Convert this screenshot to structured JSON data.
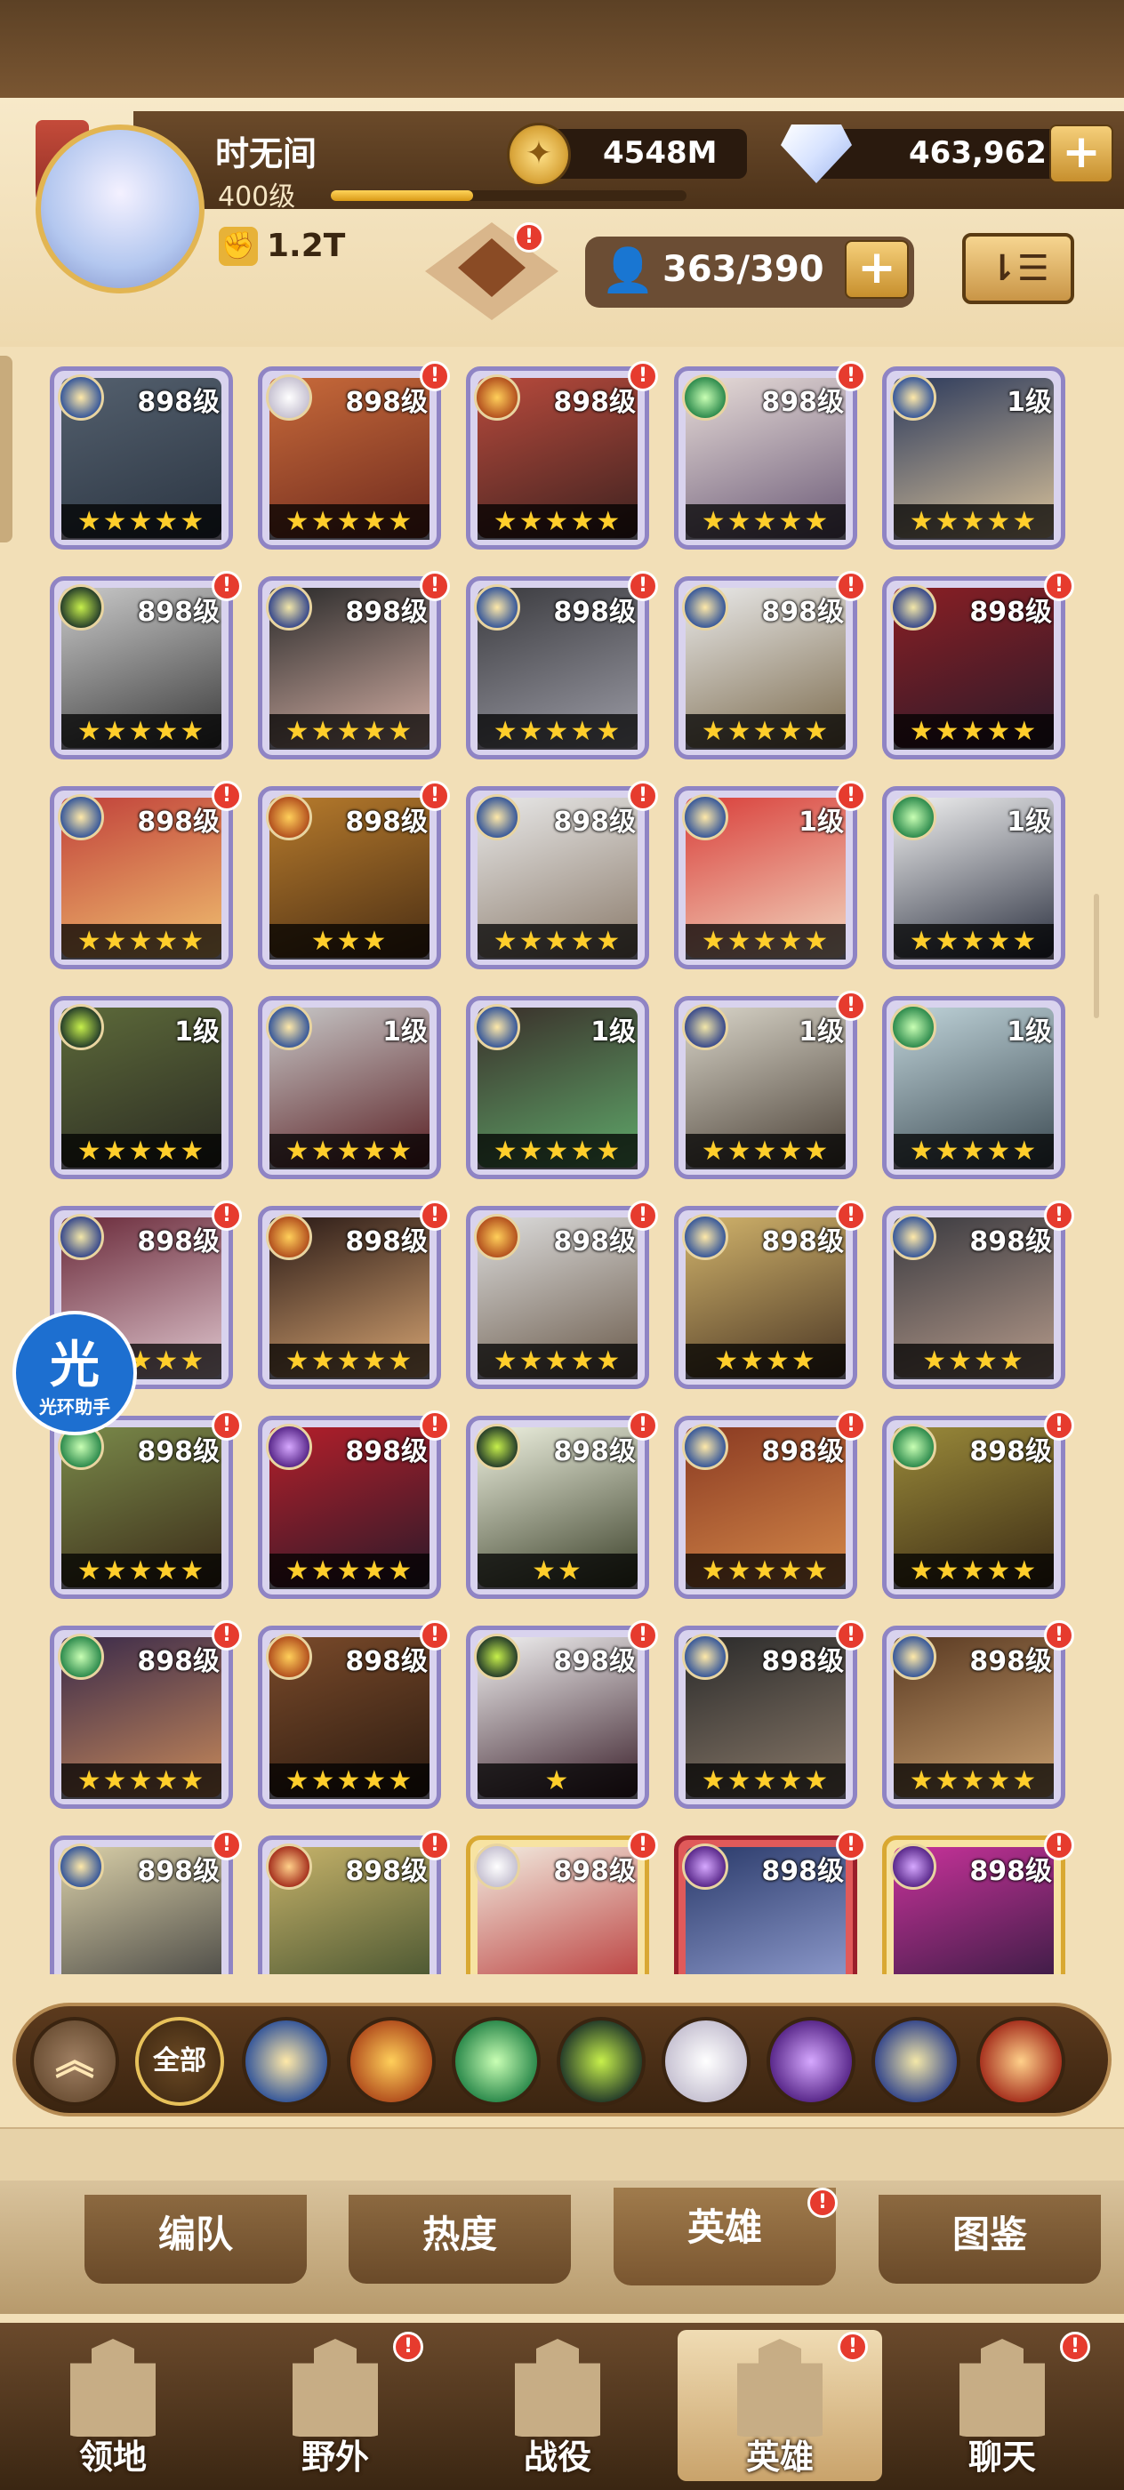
{
  "player": {
    "name": "时无间",
    "level": "400级",
    "xp_progress": 0.4,
    "power": "1.2T"
  },
  "currency": {
    "gold": "4548M",
    "diamonds": "463,962",
    "plus": "+"
  },
  "roster": {
    "count": "363/390",
    "plus": "+"
  },
  "badge": "!",
  "heroes": [
    {
      "level": "898级",
      "faction": "light",
      "stars": "★★★★★",
      "badge": false,
      "frame": "purple",
      "portrait": [
        "#54606e",
        "#2b3542"
      ]
    },
    {
      "level": "898级",
      "faction": "celestial",
      "stars": "★★★★★",
      "badge": true,
      "frame": "purple",
      "portrait": [
        "#c86a3a",
        "#6d2a1e"
      ]
    },
    {
      "level": "898级",
      "faction": "mauler",
      "stars": "★★★★★",
      "badge": true,
      "frame": "purple",
      "portrait": [
        "#b84a3c",
        "#3d2220"
      ]
    },
    {
      "level": "898级",
      "faction": "wilder",
      "stars": "★★★★★",
      "badge": true,
      "frame": "purple",
      "portrait": [
        "#e7dcd8",
        "#6b5a77"
      ]
    },
    {
      "level": "1级",
      "faction": "light",
      "stars": "★★★★★",
      "badge": false,
      "frame": "purple",
      "portrait": [
        "#2c3a5c",
        "#d9c29a"
      ]
    },
    {
      "level": "898级",
      "faction": "graveborn",
      "stars": "★★★★★",
      "badge": true,
      "frame": "purple",
      "portrait": [
        "#c9c9c9",
        "#3a3a3a"
      ]
    },
    {
      "level": "898级",
      "faction": "dimensional",
      "stars": "★★★★★",
      "badge": true,
      "frame": "purple",
      "portrait": [
        "#2a2a2a",
        "#d5b0a5"
      ]
    },
    {
      "level": "898级",
      "faction": "light",
      "stars": "★★★★★",
      "badge": true,
      "frame": "purple",
      "portrait": [
        "#3b3b3f",
        "#9c9ca6"
      ]
    },
    {
      "level": "898级",
      "faction": "light",
      "stars": "★★★★★",
      "badge": true,
      "frame": "purple",
      "portrait": [
        "#e9e9e9",
        "#7b6a4c"
      ]
    },
    {
      "level": "898级",
      "faction": "dimensional",
      "stars": "★★★★★",
      "badge": true,
      "frame": "purple",
      "portrait": [
        "#8a1f24",
        "#2a1a2a"
      ]
    },
    {
      "level": "898级",
      "faction": "light",
      "stars": "★★★★★",
      "badge": true,
      "frame": "purple",
      "portrait": [
        "#c1413a",
        "#f0c070"
      ]
    },
    {
      "level": "898级",
      "faction": "mauler",
      "stars": "★★★",
      "badge": true,
      "frame": "purple",
      "portrait": [
        "#b77b2c",
        "#4a2e14"
      ]
    },
    {
      "level": "898级",
      "faction": "light",
      "stars": "★★★★★",
      "badge": true,
      "frame": "purple",
      "portrait": [
        "#e8e8e8",
        "#8a7a6a"
      ]
    },
    {
      "level": "1级",
      "faction": "light",
      "stars": "★★★★★",
      "badge": true,
      "frame": "purple",
      "portrait": [
        "#d9403b",
        "#f2d7c0"
      ]
    },
    {
      "level": "1级",
      "faction": "wilder",
      "stars": "★★★★★",
      "badge": false,
      "frame": "purple",
      "portrait": [
        "#f1f1f1",
        "#2c3140"
      ]
    },
    {
      "level": "1级",
      "faction": "graveborn",
      "stars": "★★★★★",
      "badge": false,
      "frame": "purple",
      "portrait": [
        "#5d6a3a",
        "#2a2a22"
      ]
    },
    {
      "level": "1级",
      "faction": "light",
      "stars": "★★★★★",
      "badge": false,
      "frame": "purple",
      "portrait": [
        "#c7c7c7",
        "#5a2024"
      ]
    },
    {
      "level": "1级",
      "faction": "light",
      "stars": "★★★★★",
      "badge": false,
      "frame": "purple",
      "portrait": [
        "#3a2f2a",
        "#5fa86a"
      ]
    },
    {
      "level": "1级",
      "faction": "dimensional",
      "stars": "★★★★★",
      "badge": true,
      "frame": "purple",
      "portrait": [
        "#d8d4c8",
        "#4a4036"
      ]
    },
    {
      "level": "1级",
      "faction": "wilder",
      "stars": "★★★★★",
      "badge": false,
      "frame": "purple",
      "portrait": [
        "#bfd3d9",
        "#3c4a52"
      ]
    },
    {
      "level": "898级",
      "faction": "dimensional",
      "stars": "★★★★★",
      "badge": true,
      "frame": "purple",
      "portrait": [
        "#6a2a3a",
        "#e0c7cf"
      ]
    },
    {
      "level": "898级",
      "faction": "mauler",
      "stars": "★★★★★",
      "badge": true,
      "frame": "purple",
      "portrait": [
        "#2a1a16",
        "#d7a573"
      ]
    },
    {
      "level": "898级",
      "faction": "mauler",
      "stars": "★★★★★",
      "badge": true,
      "frame": "purple",
      "portrait": [
        "#dcdcdc",
        "#6a5a4a"
      ]
    },
    {
      "level": "898级",
      "faction": "light",
      "stars": "★★★★",
      "badge": true,
      "frame": "purple",
      "portrait": [
        "#d1b36b",
        "#4a3624"
      ]
    },
    {
      "level": "898级",
      "faction": "light",
      "stars": "★★★★",
      "badge": true,
      "frame": "purple",
      "portrait": [
        "#3a3a40",
        "#b59a8a"
      ]
    },
    {
      "level": "898级",
      "faction": "wilder",
      "stars": "★★★★★",
      "badge": true,
      "frame": "purple",
      "portrait": [
        "#7a8a4a",
        "#3a2a18"
      ]
    },
    {
      "level": "898级",
      "faction": "hypogean",
      "stars": "★★★★★",
      "badge": true,
      "frame": "purple",
      "portrait": [
        "#b41f2a",
        "#2a1a2a"
      ]
    },
    {
      "level": "898级",
      "faction": "graveborn",
      "stars": "★★",
      "badge": true,
      "frame": "purple",
      "portrait": [
        "#eef1e0",
        "#3a3f28"
      ]
    },
    {
      "level": "898级",
      "faction": "light",
      "stars": "★★★★★",
      "badge": true,
      "frame": "purple",
      "portrait": [
        "#8a3a22",
        "#d68a4a"
      ]
    },
    {
      "level": "898级",
      "faction": "wilder",
      "stars": "★★★★★",
      "badge": true,
      "frame": "purple",
      "portrait": [
        "#9a8a3a",
        "#3a2a14"
      ]
    },
    {
      "level": "898级",
      "faction": "wilder",
      "stars": "★★★★★",
      "badge": true,
      "frame": "purple",
      "portrait": [
        "#3a2a4a",
        "#c88a5a"
      ]
    },
    {
      "level": "898级",
      "faction": "mauler",
      "stars": "★★★★★",
      "badge": true,
      "frame": "purple",
      "portrait": [
        "#7a4a2a",
        "#2a1a10"
      ]
    },
    {
      "level": "898级",
      "faction": "graveborn",
      "stars": "★",
      "badge": true,
      "frame": "purple",
      "portrait": [
        "#f2f2f2",
        "#3a1f2a"
      ]
    },
    {
      "level": "898级",
      "faction": "light",
      "stars": "★★★★★",
      "badge": true,
      "frame": "purple",
      "portrait": [
        "#2a2a2a",
        "#8a7a6a"
      ]
    },
    {
      "level": "898级",
      "faction": "light",
      "stars": "★★★★★",
      "badge": true,
      "frame": "purple",
      "portrait": [
        "#5a3a22",
        "#c9a070"
      ]
    },
    {
      "level": "898级",
      "faction": "light",
      "stars": "",
      "badge": true,
      "frame": "purple",
      "portrait": [
        "#d9cfa8",
        "#3a3a3a"
      ]
    },
    {
      "level": "898级",
      "faction": "dragon",
      "stars": "",
      "badge": true,
      "frame": "purple",
      "portrait": [
        "#c7b36a",
        "#3a4a2a"
      ]
    },
    {
      "level": "898级",
      "faction": "celestial",
      "stars": "",
      "badge": true,
      "frame": "gold",
      "portrait": [
        "#f2ece0",
        "#b42a2a"
      ]
    },
    {
      "level": "898级",
      "faction": "hypogean",
      "stars": "",
      "badge": true,
      "frame": "red",
      "portrait": [
        "#2a3a6a",
        "#9aa6d8"
      ]
    },
    {
      "level": "898级",
      "faction": "hypogean",
      "stars": "",
      "badge": true,
      "frame": "gold",
      "portrait": [
        "#c8329a",
        "#2a1a3a"
      ]
    }
  ],
  "filters": {
    "collapse_icon": "chevron-up-icon",
    "all_label": "全部",
    "factions": [
      "lightbearer",
      "mauler",
      "wilder",
      "graveborn",
      "celestial",
      "hypogean",
      "dimensional",
      "dragon"
    ]
  },
  "helper": {
    "glyph": "光",
    "label": "光环助手"
  },
  "subtabs": [
    {
      "label": "编队",
      "active": false,
      "badge": false
    },
    {
      "label": "热度",
      "active": false,
      "badge": false
    },
    {
      "label": "英雄",
      "active": true,
      "badge": true
    },
    {
      "label": "图鉴",
      "active": false,
      "badge": false
    }
  ],
  "nav": [
    {
      "label": "领地",
      "active": false,
      "badge": false,
      "icon": "castle-icon"
    },
    {
      "label": "野外",
      "active": false,
      "badge": true,
      "icon": "map-scroll-icon"
    },
    {
      "label": "战役",
      "active": false,
      "badge": false,
      "icon": "sword-icon"
    },
    {
      "label": "英雄",
      "active": true,
      "badge": true,
      "icon": "helmet-icon"
    },
    {
      "label": "聊天",
      "active": false,
      "badge": true,
      "icon": "chat-icon"
    }
  ],
  "colors": {
    "accent": "#e7b238",
    "badge": "#e63b2e",
    "frame_purple": "#8f84c4"
  }
}
